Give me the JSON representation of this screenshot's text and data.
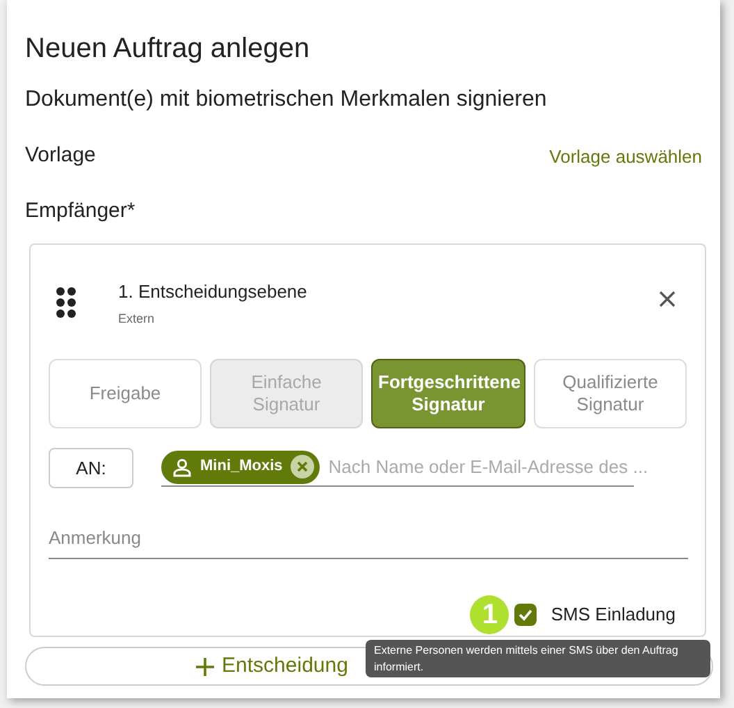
{
  "dialog": {
    "title": "Neuen Auftrag anlegen",
    "subtitle": "Dokument(e) mit biometrischen Merkmalen signieren"
  },
  "template": {
    "label": "Vorlage",
    "link": "Vorlage auswählen"
  },
  "recipients_label": "Empfänger*",
  "level": {
    "title": "1. Entscheidungsebene",
    "subtitle": "Extern",
    "types": [
      {
        "label": "Freigabe",
        "selected": false,
        "disabled": false
      },
      {
        "label": "Einfache Signatur",
        "selected": false,
        "disabled": true
      },
      {
        "label": "Fortgeschrittene Signatur",
        "selected": true,
        "disabled": false
      },
      {
        "label": "Qualifizierte Signatur",
        "selected": false,
        "disabled": false
      }
    ],
    "to_label": "AN:",
    "chips": [
      {
        "label": "Mini_Moxis"
      }
    ],
    "recipient_placeholder": "Nach Name oder E-Mail-Adresse des ...",
    "note_placeholder": "Anmerkung",
    "step_badge": "1",
    "sms": {
      "label": "SMS Einladung",
      "checked": true
    }
  },
  "add_button": "Entscheidung",
  "tooltip": "Externe Personen werden mittels einer SMS über den Auftrag informiert."
}
